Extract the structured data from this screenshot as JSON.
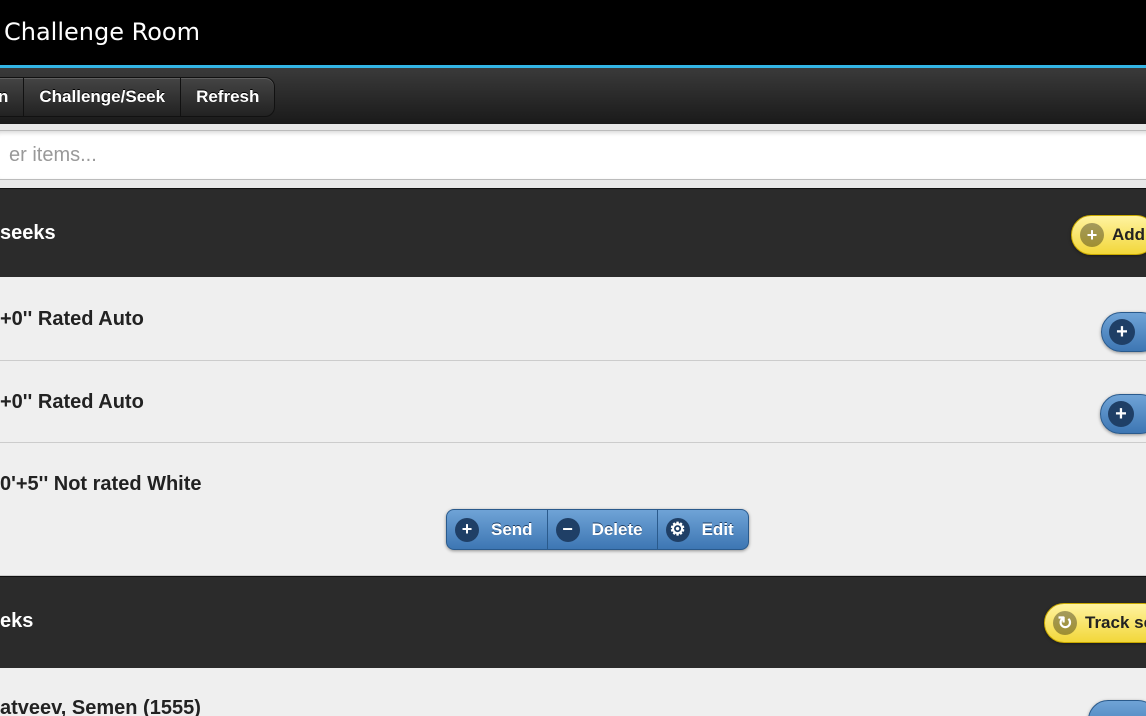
{
  "titlebar": {
    "title": "Challenge Room"
  },
  "navbar": {
    "buttons": [
      {
        "label": "n"
      },
      {
        "label": "Challenge/Seek"
      },
      {
        "label": "Refresh"
      }
    ]
  },
  "filter": {
    "placeholder": "er items..."
  },
  "my_seeks": {
    "header": "seeks",
    "add_label": "Add",
    "items": [
      {
        "text": "+0'' Rated Auto"
      },
      {
        "text": "+0'' Rated Auto"
      },
      {
        "text": "0'+5'' Not rated White"
      }
    ],
    "actions": {
      "send": "Send",
      "delete": "Delete",
      "edit": "Edit"
    }
  },
  "seeks": {
    "header": "eks",
    "track_label": "Track se",
    "items": [
      {
        "text": "atveev, Semen (1555)"
      }
    ]
  },
  "icons": {
    "plus": "plus-icon",
    "minus": "minus-icon",
    "gear": "gear-icon",
    "refresh": "refresh-icon"
  },
  "colors": {
    "accent": "#33b5e5",
    "button_blue": "#3d76b3",
    "button_yellow": "#f2d73a"
  }
}
